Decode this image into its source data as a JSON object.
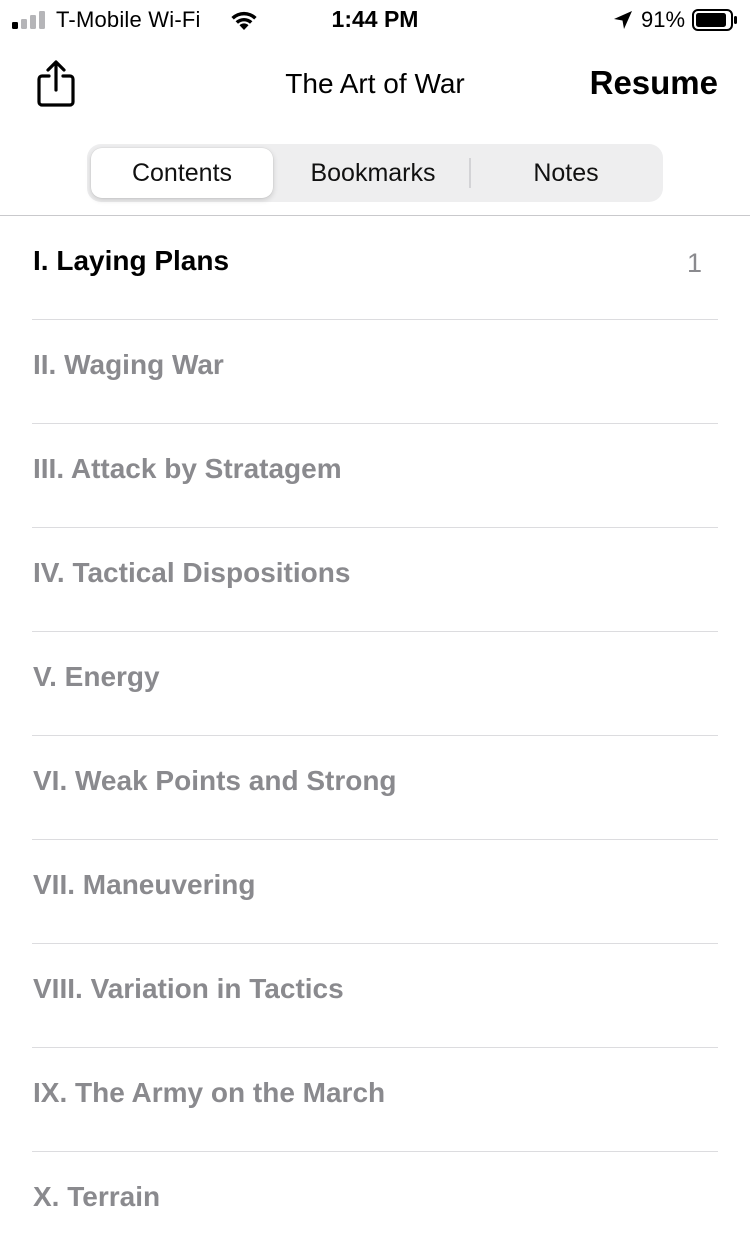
{
  "status_bar": {
    "carrier": "T-Mobile Wi-Fi",
    "time": "1:44 PM",
    "battery_percent": "91%",
    "battery_level": 0.91,
    "icons": [
      "signal-icon",
      "wifi-icon",
      "location-arrow-icon",
      "battery-icon"
    ]
  },
  "nav": {
    "share_icon": "share-icon",
    "title": "The Art of War",
    "resume_label": "Resume"
  },
  "tabs": [
    {
      "label": "Contents",
      "selected": true
    },
    {
      "label": "Bookmarks",
      "selected": false
    },
    {
      "label": "Notes",
      "selected": false
    }
  ],
  "contents": [
    {
      "title": "I. Laying Plans",
      "page": "1",
      "current": true
    },
    {
      "title": "II. Waging War",
      "page": "",
      "current": false
    },
    {
      "title": "III. Attack by Stratagem",
      "page": "",
      "current": false
    },
    {
      "title": "IV. Tactical Dispositions",
      "page": "",
      "current": false
    },
    {
      "title": "V. Energy",
      "page": "",
      "current": false
    },
    {
      "title": "VI. Weak Points and Strong",
      "page": "",
      "current": false
    },
    {
      "title": "VII. Maneuvering",
      "page": "",
      "current": false
    },
    {
      "title": "VIII. Variation in Tactics",
      "page": "",
      "current": false
    },
    {
      "title": "IX. The Army on the March",
      "page": "",
      "current": false
    },
    {
      "title": "X. Terrain",
      "page": "",
      "current": false
    }
  ],
  "colors": {
    "active_text": "#000000",
    "inactive_text": "#8a8a8e",
    "segmented_bg": "#eeeeef"
  }
}
